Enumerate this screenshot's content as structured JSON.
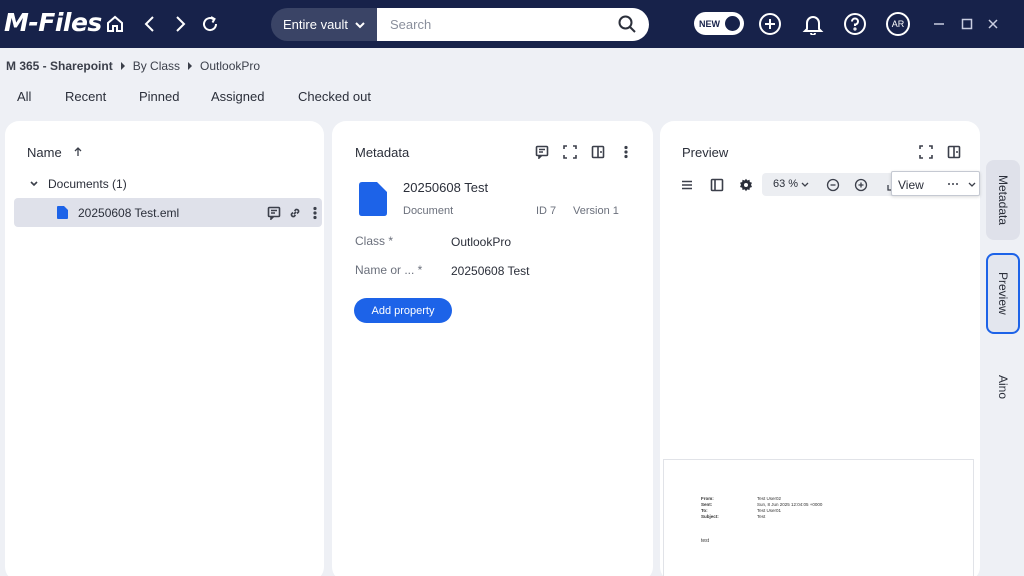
{
  "header": {
    "logo": "M-Files",
    "scope": "Entire vault",
    "search_placeholder": "Search",
    "new_label": "NEW",
    "avatar_initials": "AR"
  },
  "breadcrumb": [
    "M 365 - Sharepoint",
    "By Class",
    "OutlookPro"
  ],
  "tabs": [
    "All",
    "Recent",
    "Pinned",
    "Assigned",
    "Checked out"
  ],
  "listing": {
    "column_header": "Name",
    "group_label": "Documents (1)",
    "items": [
      {
        "name": "20250608 Test.eml"
      }
    ]
  },
  "metadata": {
    "title": "Metadata",
    "object_title": "20250608 Test",
    "object_type": "Document",
    "object_id": "ID 7",
    "object_version": "Version 1",
    "properties": [
      {
        "label": "Class *",
        "value": "OutlookPro"
      },
      {
        "label": "Name or ... *",
        "value": "20250608 Test"
      }
    ],
    "add_property_label": "Add property"
  },
  "preview": {
    "title": "Preview",
    "zoom": "63 %",
    "view_label": "View",
    "email": {
      "from_label": "From:",
      "from_value": "Test User02",
      "sent_label": "Sent:",
      "sent_value": "Sun, 8 Jun 2025 12:04:05 +0000",
      "to_label": "To:",
      "to_value": "Test User01",
      "subject_label": "Subject:",
      "subject_value": "Test",
      "body": "test"
    }
  },
  "rail": [
    "Metadata",
    "Preview",
    "Aino"
  ],
  "colors": {
    "header_bg": "#17224a",
    "accent": "#1d63e8",
    "selected_row": "#dfe1ea"
  }
}
